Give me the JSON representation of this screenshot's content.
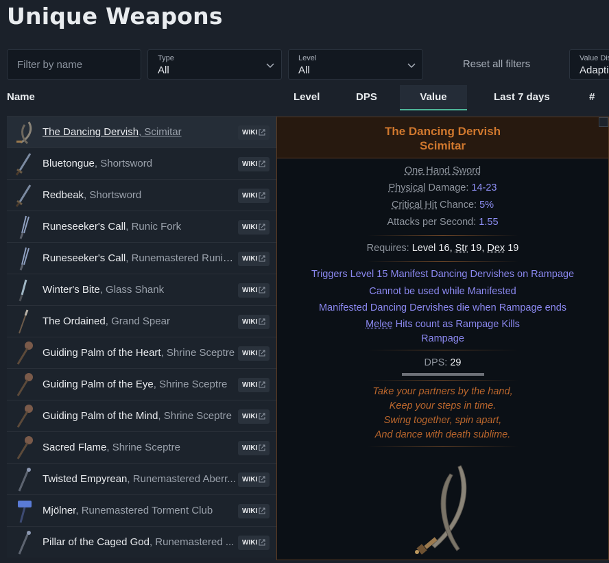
{
  "page": {
    "title": "Unique Weapons"
  },
  "filters": {
    "name_placeholder": "Filter by name",
    "type": {
      "label": "Type",
      "value": "All"
    },
    "level": {
      "label": "Level",
      "value": "All"
    },
    "reset_label": "Reset all filters",
    "value_display": {
      "label": "Value Dis",
      "value": "Adapti"
    }
  },
  "columns": {
    "name": "Name",
    "level": "Level",
    "dps": "DPS",
    "value": "Value",
    "last7": "Last 7 days",
    "listings": "# Lis"
  },
  "rows": [
    {
      "name": "The Dancing Dervish",
      "base": ", Scimitar",
      "wiki": "WIKI",
      "icon": "scimitar-icon"
    },
    {
      "name": "Bluetongue",
      "base": ", Shortsword",
      "wiki": "WIKI",
      "icon": "shortsword-icon"
    },
    {
      "name": "Redbeak",
      "base": ", Shortsword",
      "wiki": "WIKI",
      "icon": "shortsword-icon"
    },
    {
      "name": "Runeseeker's Call",
      "base": ", Runic Fork",
      "wiki": "WIKI",
      "icon": "fork-icon"
    },
    {
      "name": "Runeseeker's Call",
      "base": ", Runemastered Runic ...",
      "wiki": "WIKI",
      "icon": "fork-icon"
    },
    {
      "name": "Winter's Bite",
      "base": ", Glass Shank",
      "wiki": "WIKI",
      "icon": "shank-icon"
    },
    {
      "name": "The Ordained",
      "base": ", Grand Spear",
      "wiki": "WIKI",
      "icon": "spear-icon"
    },
    {
      "name": "Guiding Palm of the Heart",
      "base": ", Shrine Sceptre",
      "wiki": "WIKI",
      "icon": "sceptre-icon"
    },
    {
      "name": "Guiding Palm of the Eye",
      "base": ", Shrine Sceptre",
      "wiki": "WIKI",
      "icon": "sceptre-icon"
    },
    {
      "name": "Guiding Palm of the Mind",
      "base": ", Shrine Sceptre",
      "wiki": "WIKI",
      "icon": "sceptre-icon"
    },
    {
      "name": "Sacred Flame",
      "base": ", Shrine Sceptre",
      "wiki": "WIKI",
      "icon": "sceptre-icon"
    },
    {
      "name": "Twisted Empyrean",
      "base": ", Runemastered Aberr...",
      "wiki": "WIKI",
      "icon": "staff-icon"
    },
    {
      "name": "Mjölner",
      "base": ", Runemastered Torment Club",
      "wiki": "WIKI",
      "icon": "hammer-icon"
    },
    {
      "name": "Pillar of the Caged God",
      "base": ", Runemastered ...",
      "wiki": "WIKI",
      "icon": "staff-icon"
    }
  ],
  "tooltip": {
    "title": "The Dancing Dervish",
    "subtitle": "Scimitar",
    "item_class": "One Hand Sword",
    "physical_label_a": "Physical",
    "physical_label_b": " Damage: ",
    "physical_value": "14-23",
    "crit_label_a": "Critical Hit",
    "crit_label_b": " Chance: ",
    "crit_value": "5%",
    "aps_label": "Attacks per Second: ",
    "aps_value": "1.55",
    "req_label": "Requires: ",
    "req_level": "Level 16",
    "req_sep1": ", ",
    "req_str_label": "Str",
    "req_str_value": " 19",
    "req_sep2": ", ",
    "req_dex_label": "Dex",
    "req_dex_value": " 19",
    "mods": [
      "Triggers Level 15 Manifest Dancing Dervishes on Rampage",
      "Cannot be used while Manifested",
      "Manifested Dancing Dervishes die when Rampage ends"
    ],
    "mod_melee": "Melee",
    "mod_melee_rest": " Hits count as Rampage Kills",
    "mod_rampage": "Rampage",
    "dps_label": "DPS: ",
    "dps_value": "29",
    "flavor": [
      "Take your partners by the hand,",
      "Keep your steps in time.",
      "Swing together, spin apart,",
      "And dance with death sublime."
    ]
  }
}
